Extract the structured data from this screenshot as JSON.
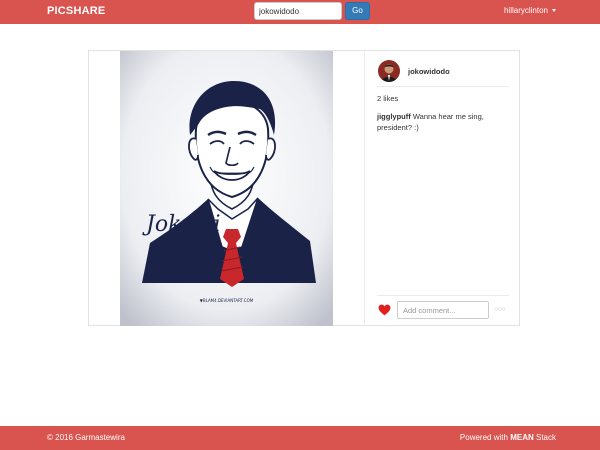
{
  "navbar": {
    "brand": "PICSHARE",
    "search": {
      "value": "jokowidodo",
      "placeholder": ""
    },
    "go_label": "Go",
    "user": "hillaryclinton"
  },
  "post": {
    "author": "jokowidodo",
    "likes": "2 likes",
    "comments": [
      {
        "user": "jigglypuff",
        "text": "Wanna hear me sing, president? :)"
      }
    ],
    "comment_placeholder": "Add comment...",
    "image": {
      "signature": "Jokowi",
      "watermark": "▼BLAM4.DEVIANTART.COM"
    }
  },
  "footer": {
    "copyright": "© 2016 Garmastewira",
    "powered_prefix": "Powered with",
    "powered_brand": "MEAN",
    "powered_suffix": "Stack"
  },
  "colors": {
    "brand_red": "#d9534f",
    "button_blue": "#337ab7",
    "heart_red": "#e02020",
    "tie_red": "#c8282c",
    "ink_navy": "#1a2347"
  },
  "icons": {
    "caret": "chevron-down-icon",
    "like": "heart-icon",
    "more": "ellipsis-icon"
  }
}
